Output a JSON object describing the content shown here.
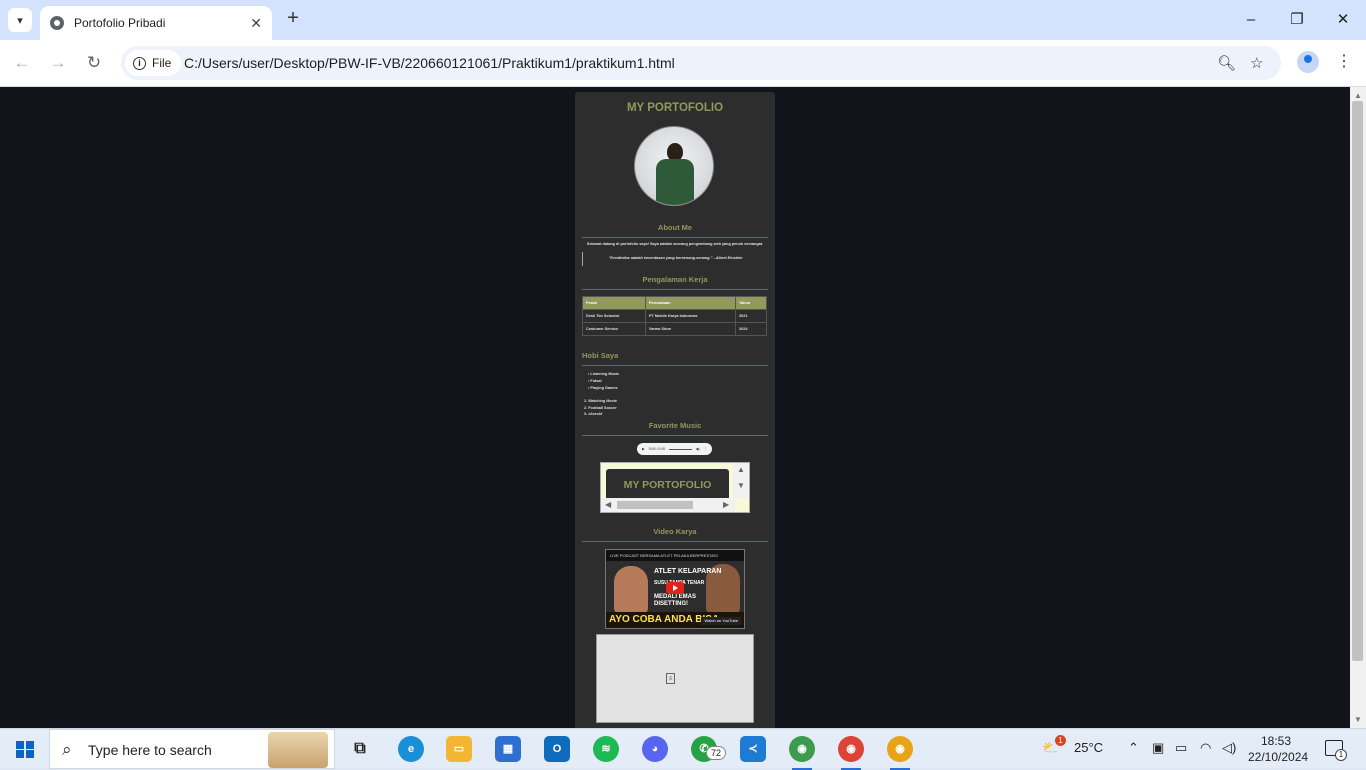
{
  "browser": {
    "tab_title": "Portofolio Pribadi",
    "url_chip": "File",
    "url": "C:/Users/user/Desktop/PBW-IF-VB/220660121061/Praktikum1/praktikum1.html"
  },
  "page": {
    "site_title": "MY PORTOFOLIO",
    "about_title": "About Me",
    "about_text": "Selamat datang di portofolio saya! Saya adalah seorang pengembang web yang penuh semangat.",
    "quote": "\"Kreativitas adalah kecerdasan yang bersenang-senang.\" - Albert Einstein",
    "work_title": "Pengalaman Kerja",
    "work_table": {
      "headers": [
        "Posisi",
        "Perusahaan",
        "Tahun"
      ],
      "rows": [
        [
          "Desk Tim Solusiwi",
          "PT Mobile Karya Indonesia",
          "2021"
        ],
        [
          "Costumer Service",
          "Varma Store",
          "2024"
        ]
      ]
    },
    "hobby_title": "Hobi Saya",
    "hobby_bullets": [
      "Listening Music",
      "Futsal",
      "Playing Games"
    ],
    "hobby_numbered": [
      "1. Watching Movie",
      "2. Football Soccer",
      "3. ciloeckf"
    ],
    "music_title": "Favorite Music",
    "audio_time": "0:00 / 0:00",
    "iframe_title": "MY PORTOFOLIO",
    "video_title": "Video Karya",
    "video": {
      "header": "LIVE PODCAST BERSAMA ATLET PELAKA BERPRESTASI",
      "caption1": "ATLET KELAPARAN",
      "caption2": "SUSU TANPA TENAR",
      "caption3": "MEDALI EMAS",
      "caption4": "DISETTING!",
      "bottom": "AYO COBA ANDA BISA",
      "yt_label": "Watch on YouTube"
    }
  },
  "taskbar": {
    "search_placeholder": "Type here to search",
    "whatsapp_badge": "72",
    "weather": "25°C",
    "time": "18:53",
    "date": "22/10/2024",
    "weather_alert": "1",
    "notification_count": "1"
  },
  "colors": {
    "page_bg": "#12141b",
    "card_bg": "#2d2d2d",
    "accent_olive": "#8f9a5c"
  }
}
